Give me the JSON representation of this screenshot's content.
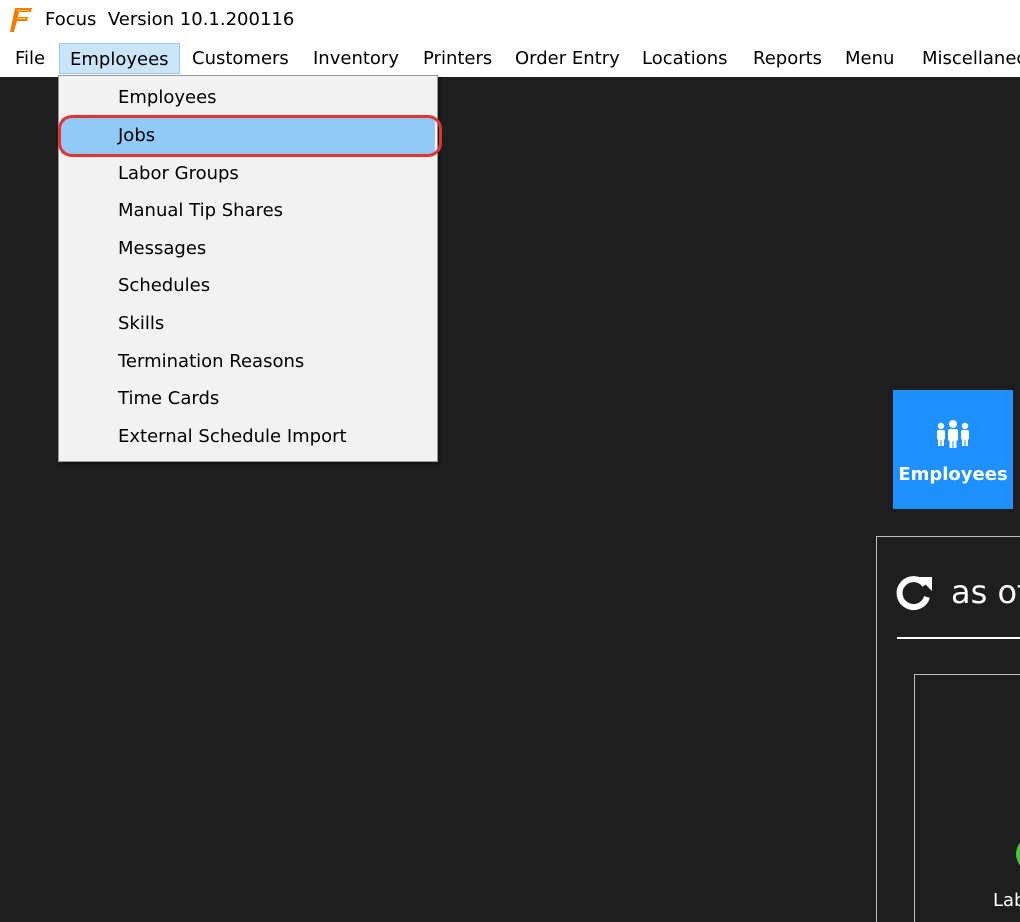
{
  "window": {
    "app_name": "Focus",
    "version_text": "Version 10.1.200116",
    "logo_icon": "focus-f-logo",
    "brand_color": "#f57c00"
  },
  "menubar": {
    "items": [
      {
        "label": "File"
      },
      {
        "label": "Employees",
        "active": true
      },
      {
        "label": "Customers"
      },
      {
        "label": "Inventory"
      },
      {
        "label": "Printers"
      },
      {
        "label": "Order Entry"
      },
      {
        "label": "Locations"
      },
      {
        "label": "Reports"
      },
      {
        "label": "Menu"
      },
      {
        "label": "Miscellaneous"
      }
    ]
  },
  "employees_menu": {
    "items": [
      {
        "label": "Employees"
      },
      {
        "label": "Jobs",
        "highlighted": true
      },
      {
        "label": "Labor Groups"
      },
      {
        "label": "Manual Tip Shares"
      },
      {
        "label": "Messages"
      },
      {
        "label": "Schedules"
      },
      {
        "label": "Skills"
      },
      {
        "label": "Termination Reasons"
      },
      {
        "label": "Time Cards"
      },
      {
        "label": "External Schedule Import"
      }
    ],
    "highlight_color": "#91c9f7",
    "annotation_color": "#e53232"
  },
  "dashboard": {
    "tile": {
      "label": "Employees",
      "icon": "people-group-icon",
      "color": "#1e90ff"
    },
    "refresh_icon": "refresh-icon",
    "as_of_text": "as of",
    "status_dot_color": "#46c83c",
    "partial_label": "Lab"
  }
}
